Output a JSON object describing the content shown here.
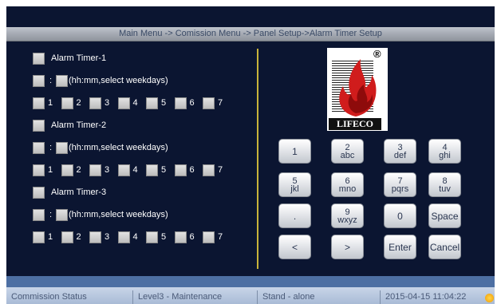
{
  "title": "Main Menu -> Comission Menu -> Panel Setup->Alarm Timer Setup",
  "timers": [
    {
      "label": "Alarm Timer-1",
      "colon": ":",
      "hint": "(hh:mm,select weekdays)",
      "days": [
        "1",
        "2",
        "3",
        "4",
        "5",
        "6",
        "7"
      ]
    },
    {
      "label": "Alarm Timer-2",
      "colon": ":",
      "hint": "(hh:mm,select weekdays)",
      "days": [
        "1",
        "2",
        "3",
        "4",
        "5",
        "6",
        "7"
      ]
    },
    {
      "label": "Alarm Timer-3",
      "colon": ":",
      "hint": "(hh:mm,select weekdays)",
      "days": [
        "1",
        "2",
        "3",
        "4",
        "5",
        "6",
        "7"
      ]
    }
  ],
  "logo": {
    "text": "LIFECO",
    "registered": "®"
  },
  "keypad": [
    [
      "1",
      ""
    ],
    [
      "2",
      "abc"
    ],
    [
      "3",
      "def"
    ],
    [
      "4",
      "ghi"
    ],
    [
      "5",
      "jkl"
    ],
    [
      "6",
      "mno"
    ],
    [
      "7",
      "pqrs"
    ],
    [
      "8",
      "tuv"
    ],
    [
      ".",
      ""
    ],
    [
      "9",
      "wxyz"
    ],
    [
      "0",
      ""
    ],
    [
      "Space",
      ""
    ],
    [
      "<",
      ""
    ],
    [
      ">",
      ""
    ],
    [
      "Enter",
      ""
    ],
    [
      "Cancel",
      ""
    ]
  ],
  "status": {
    "section": "Commission Status",
    "level": "Level3 - Maintenance",
    "mode": "Stand - alone",
    "datetime": "2015-04-15 11:04:22"
  },
  "colors": {
    "background": "#0b1531",
    "divider": "#c9b33a",
    "status_bar": "#a9bbd6",
    "logo_flame": "#d01c1c"
  }
}
